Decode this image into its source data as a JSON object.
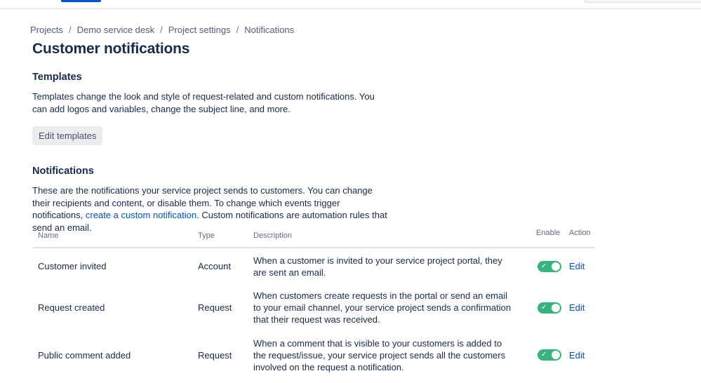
{
  "breadcrumb": {
    "items": [
      "Projects",
      "Demo service desk",
      "Project settings",
      "Notifications"
    ],
    "separator": "/"
  },
  "page_title": "Customer notifications",
  "templates": {
    "heading": "Templates",
    "description": "Templates change the look and style of request-related and custom notifications. You can add logos and variables, change the subject line, and more.",
    "button_label": "Edit templates"
  },
  "notifications": {
    "heading": "Notifications",
    "description_before": "These are the notifications your service project sends to customers. You can change their recipients and content, or disable them. To change which events trigger notifications, ",
    "link_text": "create a custom notification",
    "description_after": ". Custom notifications are automation rules that send an email.",
    "columns": {
      "name": "Name",
      "type": "Type",
      "description": "Description",
      "enable": "Enable",
      "action": "Action"
    },
    "rows": [
      {
        "name": "Customer invited",
        "type": "Account",
        "description": "When a customer is invited to your service project portal, they are sent an email.",
        "enabled": true,
        "action": "Edit"
      },
      {
        "name": "Request created",
        "type": "Request",
        "description": "When customers create requests in the portal or send an email to your email channel, your service project sends a confirmation that their request was received.",
        "enabled": true,
        "action": "Edit"
      },
      {
        "name": "Public comment added",
        "type": "Request",
        "description": "When a comment that is visible to your customers is added to the request/issue, your service project sends all the customers involved on the request a notification.",
        "enabled": true,
        "action": "Edit"
      }
    ]
  },
  "colors": {
    "link": "#0052cc",
    "toggle_on": "#36b37e",
    "text": "#172b4d"
  }
}
